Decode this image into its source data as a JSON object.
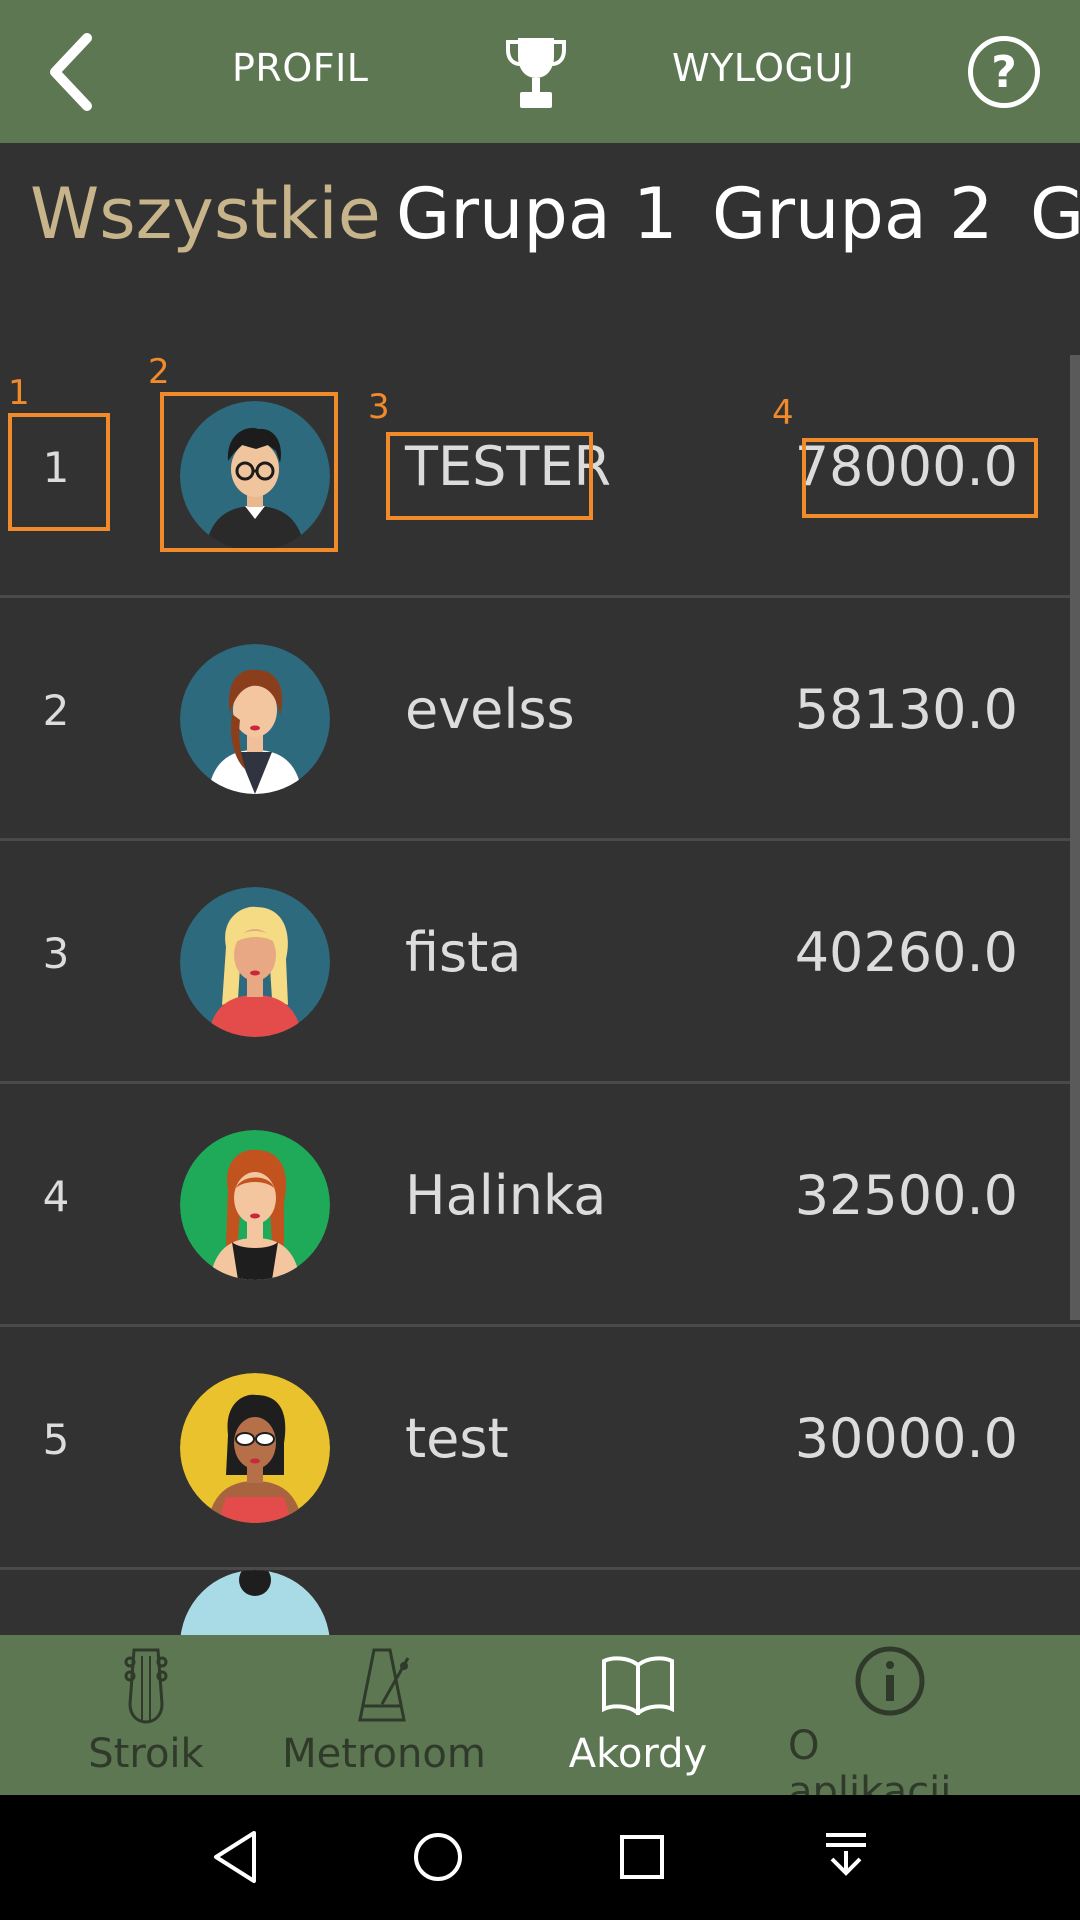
{
  "header": {
    "back_label": "back",
    "profile_label": "PROFIL",
    "logout_label": "WYLOGUJ",
    "help_glyph": "?",
    "accent_color": "#5c7752"
  },
  "tabs": [
    {
      "label": "Wszystkie",
      "active": true
    },
    {
      "label": "Grupa 1",
      "active": false
    },
    {
      "label": "Grupa 2",
      "active": false
    },
    {
      "label": "G",
      "active": false
    }
  ],
  "leaderboard": [
    {
      "rank": "1",
      "name": "TESTER",
      "score": "78000.0",
      "avatar": "man-glasses",
      "avatar_bg": "#2e6a7e"
    },
    {
      "rank": "2",
      "name": "evelss",
      "score": "58130.0",
      "avatar": "woman-brown-hair",
      "avatar_bg": "#2e6a7e"
    },
    {
      "rank": "3",
      "name": "fista",
      "score": "40260.0",
      "avatar": "woman-blonde",
      "avatar_bg": "#2e6a7e"
    },
    {
      "rank": "4",
      "name": "Halinka",
      "score": "32500.0",
      "avatar": "woman-red-hair",
      "avatar_bg": "#1faa5a"
    },
    {
      "rank": "5",
      "name": "test",
      "score": "30000.0",
      "avatar": "woman-sunglasses",
      "avatar_bg": "#e9c22e"
    }
  ],
  "annotations": [
    "1",
    "2",
    "3",
    "4"
  ],
  "bottom_nav": [
    {
      "label": "Stroik",
      "icon": "guitar-headstock-icon",
      "active": false
    },
    {
      "label": "Metronom",
      "icon": "metronome-icon",
      "active": false
    },
    {
      "label": "Akordy",
      "icon": "open-book-icon",
      "active": true
    },
    {
      "label": "O aplikacji",
      "icon": "info-icon",
      "active": false
    }
  ]
}
